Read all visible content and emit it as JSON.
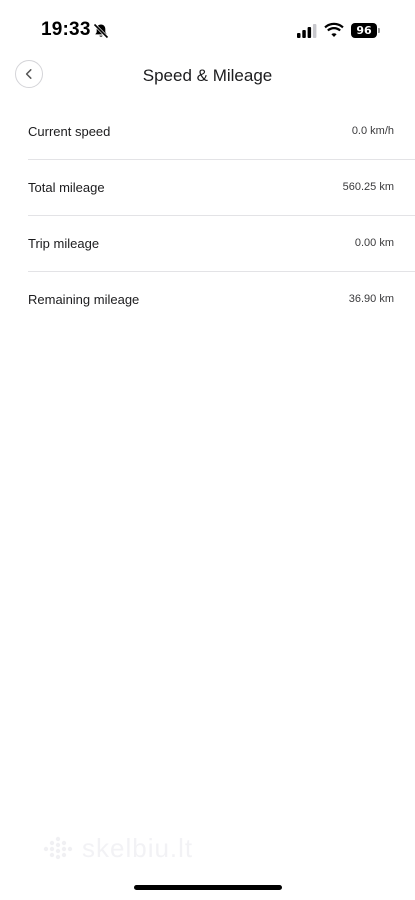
{
  "status_bar": {
    "time": "19:33",
    "battery_level": "96",
    "icons": [
      "bell-slash-icon",
      "cellular-signal-icon",
      "wifi-icon",
      "battery-icon"
    ]
  },
  "header": {
    "title": "Speed & Mileage",
    "back_icon": "chevron-left-icon"
  },
  "rows": [
    {
      "label": "Current speed",
      "value": "0.0 km/h"
    },
    {
      "label": "Total mileage",
      "value": "560.25 km"
    },
    {
      "label": "Trip mileage",
      "value": "0.00 km"
    },
    {
      "label": "Remaining mileage",
      "value": "36.90 km"
    }
  ],
  "watermark": {
    "text": "skelbiu.lt"
  },
  "colors": {
    "background": "#ffffff",
    "text": "#1c1c1e",
    "divider": "#e3e3e6"
  }
}
